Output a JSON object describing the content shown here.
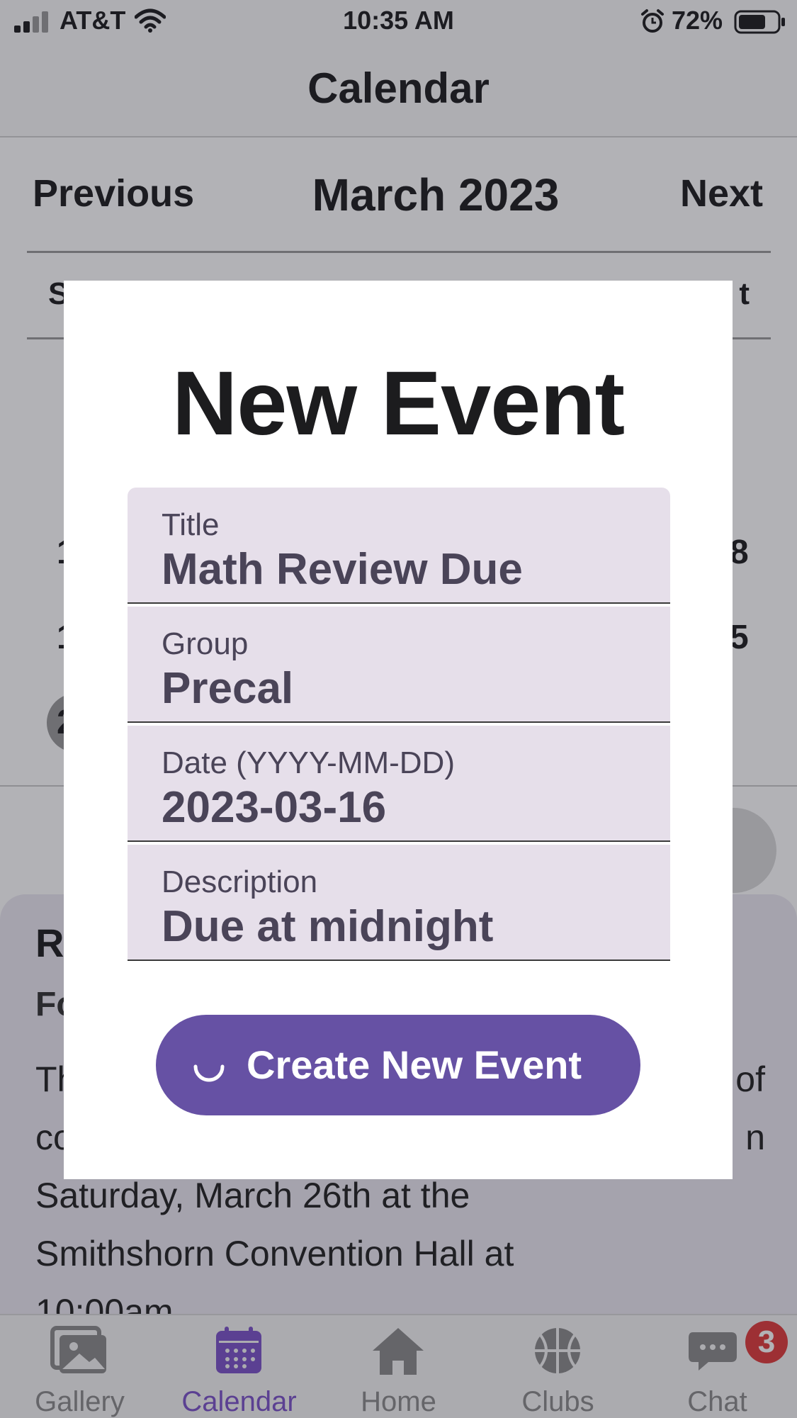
{
  "status_bar": {
    "carrier": "AT&T",
    "time": "10:35 AM",
    "battery_percent": "72%",
    "battery_level": 0.72,
    "icons": [
      "signal-icon",
      "wifi-icon",
      "alarm-icon",
      "battery-icon"
    ]
  },
  "header": {
    "title": "Calendar"
  },
  "calendar": {
    "prev_label": "Previous",
    "month_label": "March 2023",
    "next_label": "Next",
    "weekday_first_partial": "S",
    "weekday_last_partial": "t",
    "row1_first": "1",
    "row1_last": "8",
    "row2_first": "1",
    "row2_last": "5",
    "row3_first": "2"
  },
  "event_sheet": {
    "title_partial": "R",
    "subtitle_partial": "Fo",
    "line1_left": "Th",
    "line1_right": "of",
    "line2_left": "co",
    "line2_right": "n",
    "line3": "Saturday, March 26th at the",
    "line4": "Smithshorn Convention Hall at",
    "line5": "10:00am"
  },
  "modal": {
    "title": "New Event",
    "fields": [
      {
        "label": "Title",
        "value": "Math Review Due"
      },
      {
        "label": "Group",
        "value": "Precal"
      },
      {
        "label": "Date (YYYY-MM-DD)",
        "value": "2023-03-16"
      },
      {
        "label": "Description",
        "value": "Due at midnight"
      }
    ],
    "create_button_label": "Create New Event"
  },
  "tab_bar": {
    "tabs": [
      {
        "label": "Gallery",
        "icon": "gallery-icon"
      },
      {
        "label": "Calendar",
        "icon": "calendar-icon",
        "active": true
      },
      {
        "label": "Home",
        "icon": "home-icon"
      },
      {
        "label": "Clubs",
        "icon": "basketball-icon"
      },
      {
        "label": "Chat",
        "icon": "chat-icon",
        "badge": "3"
      }
    ]
  },
  "colors": {
    "accent": "#7b52c9",
    "button": "#6651a4",
    "field_bg": "#e6dfea",
    "badge": "#e03b3b"
  }
}
